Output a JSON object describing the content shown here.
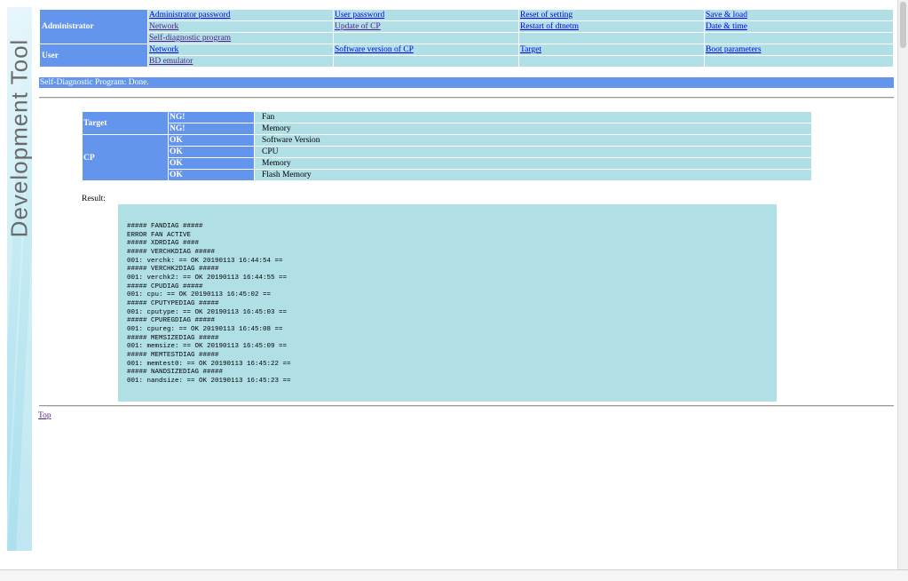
{
  "sidebar": {
    "brand": "Development Tool"
  },
  "menu": {
    "rows": [
      {
        "role": "Administrator",
        "cells": [
          "Administrator password",
          "User password",
          "Reset of setting",
          "Save & load"
        ]
      },
      {
        "role": "",
        "cells": [
          "Network",
          "Update of CP",
          "Restart of dtnetm",
          "Date & time"
        ]
      },
      {
        "role": "",
        "cells": [
          "Self-diagnostic program",
          "",
          "",
          ""
        ]
      },
      {
        "role": "User",
        "cells": [
          "Network",
          "Software version of CP",
          "Target",
          "Boot parameters"
        ]
      },
      {
        "role": "",
        "cells": [
          "BD emulator",
          "",
          "",
          ""
        ]
      }
    ]
  },
  "status": {
    "message": "Self-Diagnostic Program: Done."
  },
  "results": {
    "groups": [
      {
        "name": "Target",
        "items": [
          {
            "status": "NG!",
            "item": "Fan"
          },
          {
            "status": "NG!",
            "item": "Memory"
          }
        ]
      },
      {
        "name": "CP",
        "items": [
          {
            "status": "OK",
            "item": "Software Version"
          },
          {
            "status": "OK",
            "item": "CPU"
          },
          {
            "status": "OK",
            "item": "Memory"
          },
          {
            "status": "OK",
            "item": "Flash Memory"
          }
        ]
      }
    ]
  },
  "result_label": "Result:",
  "log_text": "##### FANDIAG #####\nERROR FAN ACTIVE\n##### XDRDIAG ####\n##### VERCHKDIAG #####\n001: verchk: == OK 20190113 16:44:54 ==\n##### VERCHK2DIAG #####\n001: verchk2: == OK 20190113 16:44:55 ==\n##### CPUDIAG #####\n001: cpu: == OK 20190113 16:45:02 ==\n##### CPUTYPEDIAG #####\n001: cputype: == OK 20190113 16:45:03 ==\n##### CPUREGDIAG #####\n001: cpureg: == OK 20190113 16:45:08 ==\n##### MEMSIZEDIAG #####\n001: memsize: == OK 20190113 16:45:09 ==\n##### MEMTESTDIAG #####\n001: memtest0: == OK 20190113 16:45:22 ==\n##### NANDSIZEDIAG #####\n001: nandsize: == OK 20190113 16:45:23 ==",
  "footer": {
    "top_link": "Top"
  },
  "colors": {
    "header_blue": "#6495ed",
    "cell_cyan": "#b0e0e6",
    "link": "#0000ee",
    "visited": "#551a8b"
  }
}
